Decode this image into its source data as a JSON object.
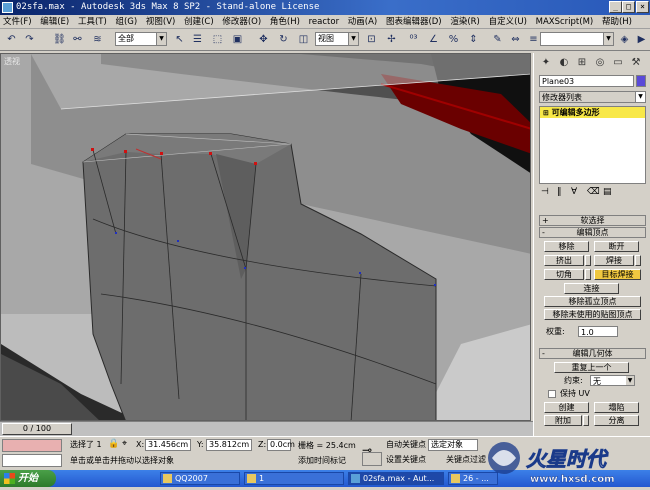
{
  "window": {
    "title": "02sfa.max - Autodesk 3ds Max 8 SP2 - Stand-alone License"
  },
  "menu": [
    "文件(F)",
    "编辑(E)",
    "工具(T)",
    "组(G)",
    "视图(V)",
    "创建(C)",
    "修改器(O)",
    "角色(H)",
    "reactor",
    "动画(A)",
    "图表编辑器(D)",
    "渲染(R)",
    "自定义(U)",
    "MAXScript(M)",
    "帮助(H)"
  ],
  "toolbar": {
    "selection_filter": "全部",
    "ref_coord": "视图",
    "named_selection": ""
  },
  "viewport": {
    "label": "透视"
  },
  "command_panel": {
    "object_name": "Plane03",
    "object_color": "#5a4ad8",
    "modifier_list_label": "修改器列表",
    "stack_item": "可编辑多边形",
    "rollouts": {
      "soft_selection": "软选择",
      "edit_vertices": "编辑顶点",
      "edit_geometry": "编辑几何体"
    },
    "buttons": {
      "remove": "移除",
      "break": "断开",
      "extrude": "挤出",
      "weld": "焊接",
      "chamfer": "切角",
      "target_weld": "目标焊接",
      "connect": "连接",
      "remove_isolated": "移除孤立顶点",
      "remove_unused_map": "移除未使用的贴图顶点",
      "repeat_last": "重复上一个",
      "collapse": "塌陷",
      "create": "创建",
      "attach": "附加",
      "detach": "分离"
    },
    "weight_label": "权重:",
    "weight_value": "1.0",
    "constraint_label": "约束:",
    "constraint_value": "无",
    "preserve_uv": "保持 UV"
  },
  "timeslider": {
    "frame_label": "0 / 100"
  },
  "status": {
    "selected": "选择了 1",
    "x_label": "X:",
    "x_value": "31.456cm",
    "y_label": "Y:",
    "y_value": "35.812cm",
    "z_label": "Z:",
    "z_value": "0.0cm",
    "grid": "栅格 = 25.4cm",
    "auto_key": "自动关键点",
    "set_key": "设置关键点",
    "selected_object": "选定对象",
    "key_filters": "关键点过滤",
    "prompt": "单击或单击并拖动以选择对象",
    "add_time_tag": "添加时间标记"
  },
  "taskbar": {
    "start": "开始",
    "tasks": [
      "QQ2007",
      "1",
      "02sfa.max - Aut...",
      "26 - ..."
    ]
  },
  "watermark": {
    "logo_text": "火星时代",
    "url": "www.hxsd.com"
  }
}
